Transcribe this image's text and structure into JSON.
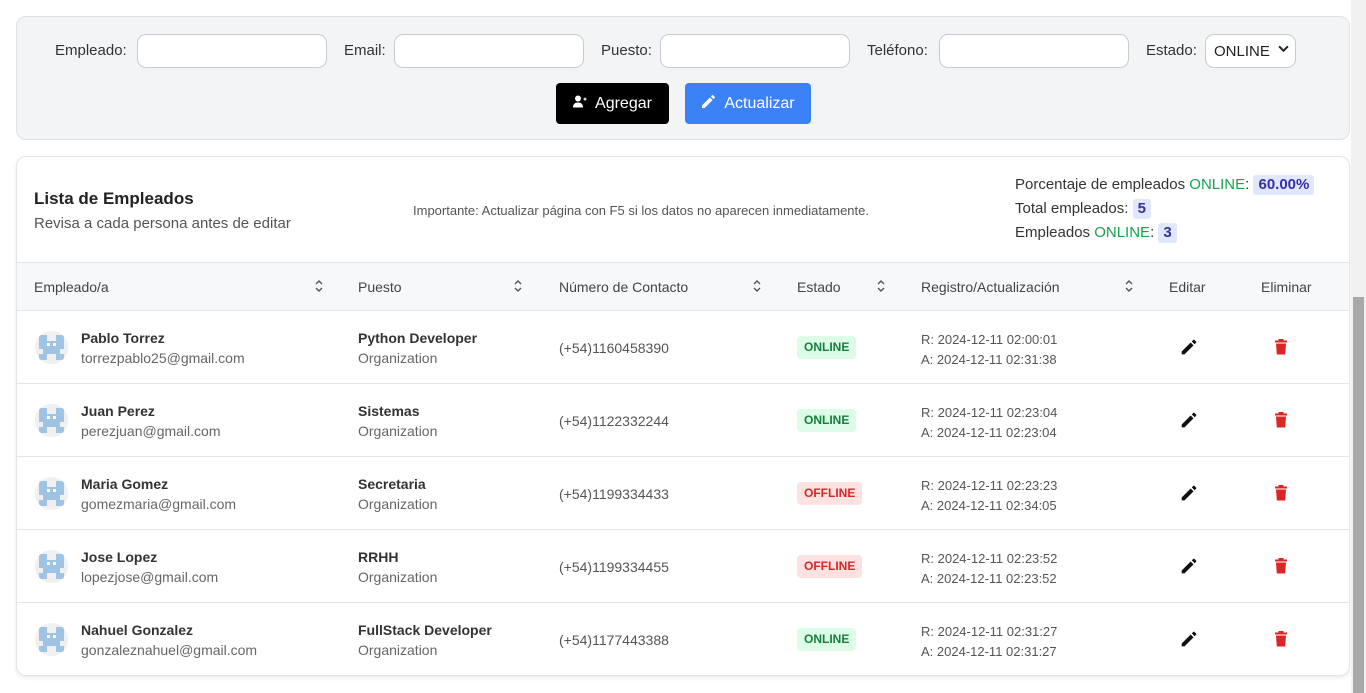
{
  "form": {
    "labels": {
      "empleado": "Empleado:",
      "email": "Email:",
      "puesto": "Puesto:",
      "telefono": "Teléfono:",
      "estado": "Estado:"
    },
    "estado_selected": "ONLINE",
    "add_label": "Agregar",
    "update_label": "Actualizar"
  },
  "list": {
    "title": "Lista de Empleados",
    "subtitle": "Revisa a cada persona antes de editar",
    "important": "Importante: Actualizar página con F5 si los datos no aparecen inmediatamente.",
    "stats": {
      "percent_prefix": "Porcentaje de empleados ",
      "online_word": "ONLINE",
      "colon": ":",
      "percent_value": "60.00%",
      "total_label": "Total empleados:",
      "total_value": "5",
      "online_prefix": "Empleados ",
      "online_value": "3"
    },
    "columns": {
      "empleado": "Empleado/a",
      "puesto": "Puesto",
      "contacto": "Número de Contacto",
      "estado": "Estado",
      "registro": "Registro/Actualización",
      "editar": "Editar",
      "eliminar": "Eliminar"
    },
    "rows": [
      {
        "name": "Pablo Torrez",
        "email": "torrezpablo25@gmail.com",
        "position": "Python Developer",
        "org": "Organization",
        "phone": "(+54)1160458390",
        "status": "ONLINE",
        "reg": "R: 2024-12-11 02:00:01",
        "upd": "A: 2024-12-11 02:31:38"
      },
      {
        "name": "Juan Perez",
        "email": "perezjuan@gmail.com",
        "position": "Sistemas",
        "org": "Organization",
        "phone": "(+54)1122332244",
        "status": "ONLINE",
        "reg": "R: 2024-12-11 02:23:04",
        "upd": "A: 2024-12-11 02:23:04"
      },
      {
        "name": "Maria Gomez",
        "email": "gomezmaria@gmail.com",
        "position": "Secretaria",
        "org": "Organization",
        "phone": "(+54)1199334433",
        "status": "OFFLINE",
        "reg": "R: 2024-12-11 02:23:23",
        "upd": "A: 2024-12-11 02:34:05"
      },
      {
        "name": "Jose Lopez",
        "email": "lopezjose@gmail.com",
        "position": "RRHH",
        "org": "Organization",
        "phone": "(+54)1199334455",
        "status": "OFFLINE",
        "reg": "R: 2024-12-11 02:23:52",
        "upd": "A: 2024-12-11 02:23:52"
      },
      {
        "name": "Nahuel Gonzalez",
        "email": "gonzaleznahuel@gmail.com",
        "position": "FullStack Developer",
        "org": "Organization",
        "phone": "(+54)1177443388",
        "status": "ONLINE",
        "reg": "R: 2024-12-11 02:31:27",
        "upd": "A: 2024-12-11 02:31:27"
      }
    ]
  },
  "colors": {
    "online": "#16a34a",
    "offline": "#dc2626",
    "primary": "#3b82f6",
    "delete": "#dc2626"
  }
}
